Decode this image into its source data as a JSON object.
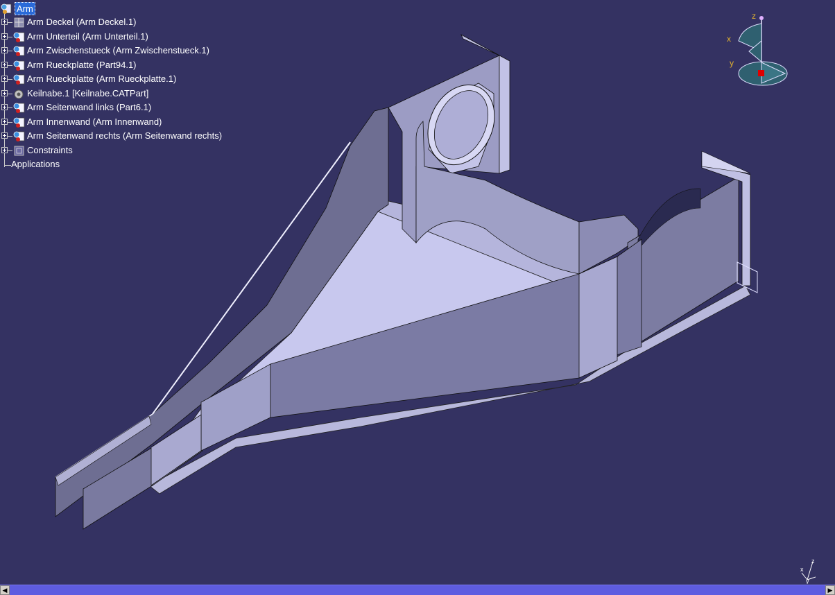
{
  "tree": {
    "root": "Arm",
    "items": [
      {
        "label": "Arm Deckel (Arm Deckel.1)",
        "icon": "sheetmetal-part-icon"
      },
      {
        "label": "Arm Unterteil (Arm Unterteil.1)",
        "icon": "part-icon"
      },
      {
        "label": "Arm Zwischenstueck (Arm Zwischenstueck.1)",
        "icon": "part-icon"
      },
      {
        "label": "Arm Rueckplatte (Part94.1)",
        "icon": "part-icon"
      },
      {
        "label": "Arm Rueckplatte (Arm Rueckplatte.1)",
        "icon": "part-icon"
      },
      {
        "label": "Keilnabe.1 [Keilnabe.CATPart]",
        "icon": "gear-part-icon"
      },
      {
        "label": "Arm Seitenwand links (Part6.1)",
        "icon": "part-icon"
      },
      {
        "label": "Arm Innenwand (Arm Innenwand)",
        "icon": "part-icon"
      },
      {
        "label": "Arm Seitenwand rechts (Arm Seitenwand rechts)",
        "icon": "part-icon"
      },
      {
        "label": "Constraints",
        "icon": "constraints-icon"
      }
    ],
    "applications": "Applications"
  },
  "compass": {
    "x": "x",
    "y": "y",
    "z": "z"
  },
  "mini_axis": {
    "x": "x",
    "y": "y",
    "z": "z"
  },
  "colors": {
    "background": "#343262",
    "part_light": "#c9c9ec",
    "part_mid": "#9c9cc4",
    "part_dark": "#6e6e90",
    "selection": "#2a6ad8",
    "statusbar": "#5e5ce0"
  }
}
